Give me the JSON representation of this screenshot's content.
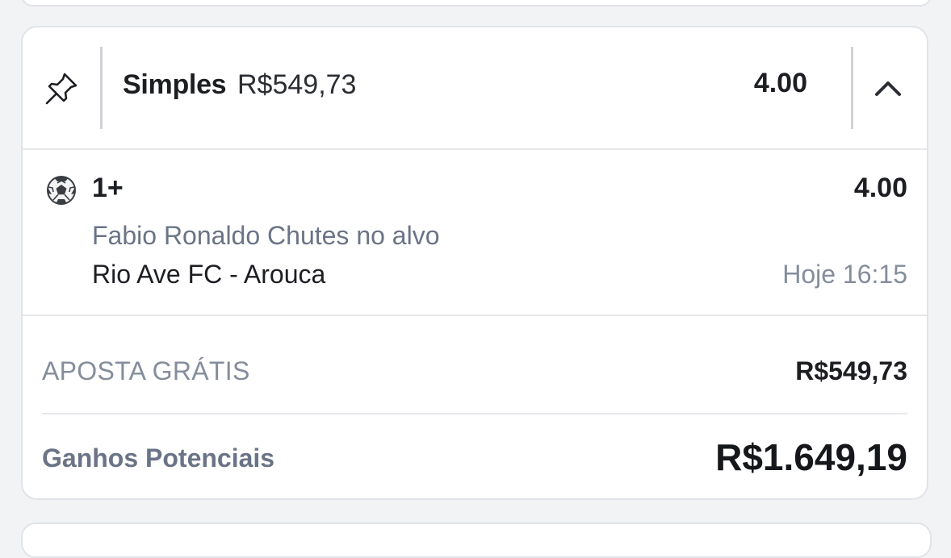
{
  "bet_slip": {
    "header": {
      "bet_type": "Simples",
      "stake": "R$549,73",
      "total_odds": "4.00",
      "pin_icon": "pin-icon",
      "collapse_icon": "chevron-up-icon"
    },
    "selection": {
      "sport_icon": "soccer-ball-icon",
      "name": "1+",
      "odds": "4.00",
      "market": "Fabio Ronaldo Chutes no alvo",
      "event": "Rio Ave FC - Arouca",
      "time": "Hoje 16:15"
    },
    "stake_row": {
      "label": "APOSTA GRÁTIS",
      "value": "R$549,73"
    },
    "winnings_row": {
      "label": "Ganhos Potenciais",
      "value": "R$1.649,19"
    }
  },
  "colors": {
    "background": "#f2f3f5",
    "card": "#ffffff",
    "border": "#e1e3e8",
    "muted_text": "#6b7486",
    "light_text": "#858d9c",
    "primary_text": "#1c1e22"
  }
}
